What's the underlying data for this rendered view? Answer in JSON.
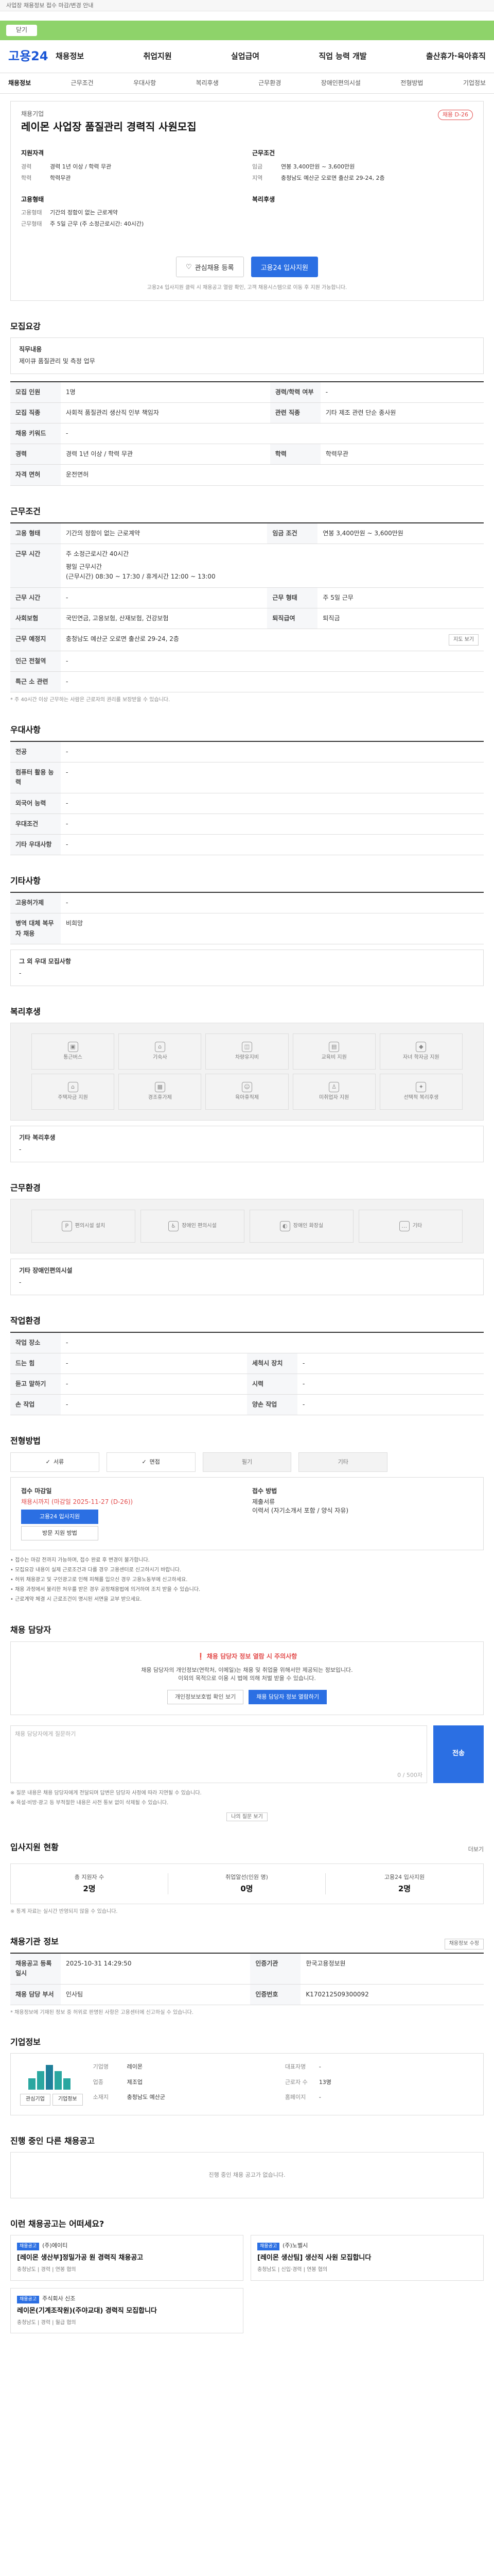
{
  "topbar": {
    "text": "사업장 채용정보 접수 마감/변경 안내"
  },
  "greenbar": {
    "label": "닫기",
    "close": "×"
  },
  "header": {
    "logo": "고용24",
    "menus": [
      "채용정보",
      "취업지원",
      "실업급여",
      "직업 능력 개발",
      "출산휴가·육아휴직"
    ]
  },
  "subnav": [
    "채용정보",
    "근무조건",
    "우대사항",
    "복리후생",
    "근무환경",
    "장애인편의시설",
    "전형방법",
    "기업정보"
  ],
  "job": {
    "company": "채용기업",
    "title": "레이몬 사업장 품질관리 경력직 사원모집",
    "badge": "채용 D-26",
    "req_title": "지원자격",
    "req": [
      {
        "k": "경력",
        "v": "경력 1년 이상 / 학력 무관"
      },
      {
        "k": "학력",
        "v": "학력무관"
      }
    ],
    "cond_title": "근무조건",
    "cond": [
      {
        "k": "임금",
        "v": "연봉 3,400만원 ~ 3,600만원"
      },
      {
        "k": "지역",
        "v": "충청남도 예산군 오로면 출산로 29-24, 2층"
      }
    ],
    "form_title": "고용형태",
    "form": [
      {
        "k": "고용형태",
        "v": "기간의 정함이 없는 근로계약"
      },
      {
        "k": "근무형태",
        "v": "주 5일 근무 (주 소정근로시간: 40시간)"
      }
    ],
    "welfare_title": "복리후생",
    "welfare": [],
    "scrap": "관심채용 등록",
    "apply": "고용24 입사지원",
    "note": "고용24 입사지원 클릭 시 채용공고 열람 확인, 고객 채용시스템으로 이동 후 지원 가능합니다."
  },
  "detail": {
    "title": "모집요강",
    "job_title_label": "직무내용",
    "job_title_value": "제이큐 품질관리 및 측정 업무",
    "rows": [
      [
        "모집 인원",
        "1명",
        "경력/학력 여부",
        "-"
      ],
      [
        "모집 직종",
        "사회적 품질관리 생산직 인부 책임자",
        "관련 직종",
        "기타 제조 관련 단순 종사원"
      ],
      [
        "채용 키워드",
        "-",
        "",
        ""
      ],
      [
        "경력",
        "경력 1년 이상 / 학력 무관",
        "학력",
        "학력무관"
      ],
      [
        "자격 면허",
        "운전면허",
        "",
        ""
      ]
    ]
  },
  "work": {
    "title": "근무조건",
    "pay_label": "고용 형태",
    "pay_value": "기간의 정함이 없는 근로계약",
    "wage_label": "임금 조건",
    "wage_value": "연봉 3,400만원 ~ 3,600만원",
    "rows": [
      [
        "근무 시간",
        "주 소정근로시간 40시간",
        "",
        ""
      ],
      [
        "근무 예정지",
        "충청남도 예산군 오로면 출산로 29-24, 2층",
        "",
        ""
      ],
      [
        "근무 시간",
        "-",
        "근무 형태",
        "주 5일 근무"
      ],
      [
        "사회보험",
        "국민연금, 고용보험, 산재보험, 건강보험",
        "퇴직급여",
        "퇴직금"
      ],
      [
        "근무 예정지",
        "충청남도 예산군 오로면 출산로 29-24, 2층",
        "",
        ""
      ],
      [
        "인근 전철역",
        "-",
        "",
        ""
      ],
      [
        "특근 소 관련",
        "-",
        "",
        ""
      ]
    ],
    "hours": "평일 근무시간\n(근무시간) 08:30 ~ 17:30 / 휴게시간 12:00 ~ 13:00",
    "map_btn": "지도 보기",
    "note": "* 주 40시간 이상 근무하는 사람은 근로자의 권리를 보장받을 수 있습니다."
  },
  "prefer": {
    "title": "우대사항",
    "rows": [
      [
        "전공",
        "-"
      ],
      [
        "컴퓨터 활용 능력",
        "-"
      ],
      [
        "외국어 능력",
        "-"
      ],
      [
        "우대조건",
        "-"
      ],
      [
        "기타 우대사항",
        "-"
      ]
    ]
  },
  "other": {
    "title": "기타사항",
    "rows": [
      [
        "고용허가제",
        "-"
      ],
      [
        "병역 대체 복무자 채용",
        "비희망"
      ]
    ],
    "extra_label": "그 외 우대 모집사항",
    "extra_value": "-"
  },
  "benefits": {
    "title": "복리후생",
    "items": [
      "통근버스",
      "기숙사",
      "차량유지비",
      "교육비 지원",
      "자녀 학자금 지원",
      "주택자금 지원",
      "경조휴가제",
      "육아휴직제",
      "미취업자 지원",
      "선택적 복리후생"
    ],
    "extra_label": "기타 복리후생",
    "extra_value": "-"
  },
  "env": {
    "title": "근무환경",
    "items": [
      "편의시설 설치",
      "장애인 편의시설",
      "장애인 화장실",
      "기타"
    ],
    "extra_label": "기타 장애인편의시설",
    "extra_value": "-"
  },
  "process": {
    "title": "작업환경",
    "rows": [
      [
        "작업 장소",
        "-",
        "",
        ""
      ],
      [
        "드는 힘",
        "-",
        "세척시 장치",
        "-"
      ],
      [
        "듣고 말하기",
        "-",
        "시력",
        "-"
      ],
      [
        "손 작업",
        "-",
        "양손 작업",
        "-"
      ]
    ]
  },
  "selection": {
    "title": "전형방법",
    "methods": [
      "서류",
      "면접",
      "필기",
      "기타"
    ],
    "deadline_label": "접수 마감일",
    "deadline": "채용시까지 (마감일 2025-11-27 (D-26))",
    "apply_btn": "고용24 입사지원",
    "visit_btn": "방문 지원 방법",
    "docs_label": "접수 방법",
    "docs": "제출서류\n이력서 (자기소개서 포함 / 양식 자유)",
    "bullets": [
      "• 접수는 마감 전까지 가능하며, 접수 완료 후 변경이 불가합니다.",
      "• 모집요강 내용이 실제 근로조건과 다를 경우 고용센터로 신고하시기 바랍니다.",
      "• 허위 채용광고 및 구인광고로 인해 피해를 입으신 경우 고용노동부에 신고하세요.",
      "• 채용 과정에서 불리한 처우를 받은 경우 공정채용법에 의거하여 조치 받을 수 있습니다.",
      "• 근로계약 체결 시 근로조건이 명시된 서면을 교부 받으세요."
    ]
  },
  "contact": {
    "title": "채용 담당자",
    "warn": "채용 담당자 정보 열람 시 주의사항",
    "warn_text": "채용 담당자의 개인정보(연락처, 이메일)는 채용 및 취업을 위해서만 제공되는 정보입니다.",
    "warn_text2": "이외의 목적으로 이용 시 법에 의해 처벌 받을 수 있습니다.",
    "b1": "개인정보보호법 확인 보기",
    "b2": "채용 담당자 정보 열람하기",
    "q_placeholder": "채용 담당자에게 질문하기",
    "q_count": "0 / 500자",
    "q_btn": "전송",
    "notes": [
      "※ 질문 내용은 채용 담당자에게 전달되며 답변은 담당자 사정에 따라 지연될 수 있습니다.",
      "※ 욕설·비방·광고 등 부적절한 내용은 사전 통보 없이 삭제될 수 있습니다."
    ],
    "q_more": "나의 질문 보기"
  },
  "stats": {
    "title": "입사지원 현황",
    "more": "더보기",
    "items": [
      {
        "l": "총 지원자 수",
        "v": "2명"
      },
      {
        "l": "취업알선(인원 명)",
        "v": "0명"
      },
      {
        "l": "고용24 입사지원",
        "v": "2명"
      }
    ],
    "note": "※ 통계 자료는 실시간 반영되지 않을 수 있습니다."
  },
  "info": {
    "title": "채용기관 정보",
    "btn": "채용정보 수정",
    "rows": [
      [
        "채용공고 등록일시",
        "2025-10-31 14:29:50",
        "인증기관",
        "한국고용정보원"
      ],
      [
        "채용 담당 부서",
        "인사팀",
        "인증번호",
        "K170212509300092"
      ]
    ],
    "note": "* 채용정보에 기재된 정보 중 허위로 판명된 사항은 고용센터에 신고하실 수 있습니다."
  },
  "company": {
    "title": "기업정보",
    "rows": [
      [
        "기업명",
        "레이몬",
        "대표자명",
        "-"
      ],
      [
        "업종",
        "제조업",
        "근로자 수",
        "13명"
      ],
      [
        "소재지",
        "충청남도 예산군",
        "홈페이지",
        "-"
      ]
    ],
    "b1": "관심기업",
    "b2": "기업정보"
  },
  "similar": {
    "title": "진행 중인 다른 채용공고",
    "empty": "진행 중인 채용 공고가 없습니다."
  },
  "rec": {
    "title": "이런 채용공고는 어떠세요?",
    "items": [
      {
        "tag": "채용공고",
        "co": "(주)에이티",
        "title": "[레이몬 생산부]정밀가공 원 경력직 채용공고",
        "sub": "충청남도 | 경력 | 연봉 협의"
      },
      {
        "tag": "채용공고",
        "co": "(주)노벨시",
        "title": "[레이몬 생산팀] 생산직 사원 모집합니다",
        "sub": "충청남도 | 신입·경력 | 연봉 협의"
      },
      {
        "tag": "채용공고",
        "co": "주식회사 신조",
        "title": "레이몬(기계조작원)(주야교대) 경력직 모집합니다",
        "sub": "충청남도 | 경력 | 월급 협의"
      }
    ]
  }
}
